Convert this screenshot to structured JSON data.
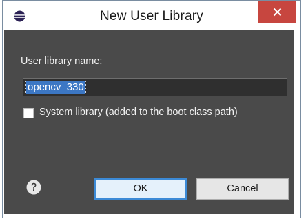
{
  "window": {
    "title": "New User Library",
    "close_glyph": "×",
    "app_icon": "eclipse-icon",
    "accent_color": "#c7463f"
  },
  "form": {
    "name_label_accel": "U",
    "name_label_rest": "ser library name:",
    "name_value": "opencv_330",
    "system_checked": false,
    "system_label_accel": "S",
    "system_label_rest": "ystem library (added to the boot class path)"
  },
  "buttons": {
    "help_icon": "help-icon",
    "ok_label": "OK",
    "cancel_label": "Cancel"
  }
}
